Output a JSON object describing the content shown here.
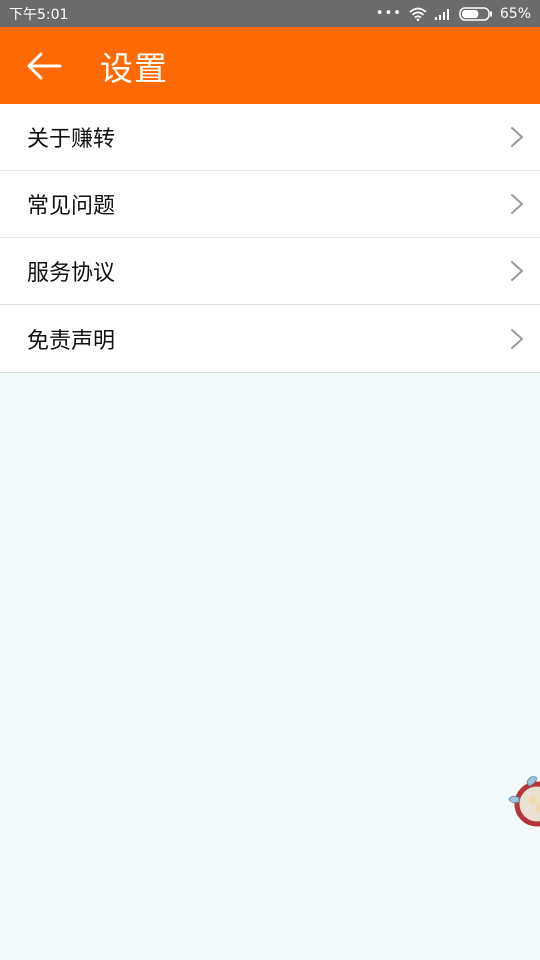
{
  "status_bar": {
    "time": "下午5:01",
    "dots": "•••",
    "battery_percent": "65%",
    "battery_level": 0.65
  },
  "header": {
    "title": "设置",
    "background_color": "#ff6a05"
  },
  "menu": {
    "items": [
      {
        "label": "关于赚转"
      },
      {
        "label": "常见问题"
      },
      {
        "label": "服务协议"
      },
      {
        "label": "免责声明"
      }
    ]
  },
  "icons": {
    "back": "arrow-left-icon",
    "chevron": "chevron-right-icon",
    "floating": "mascot-icon"
  }
}
